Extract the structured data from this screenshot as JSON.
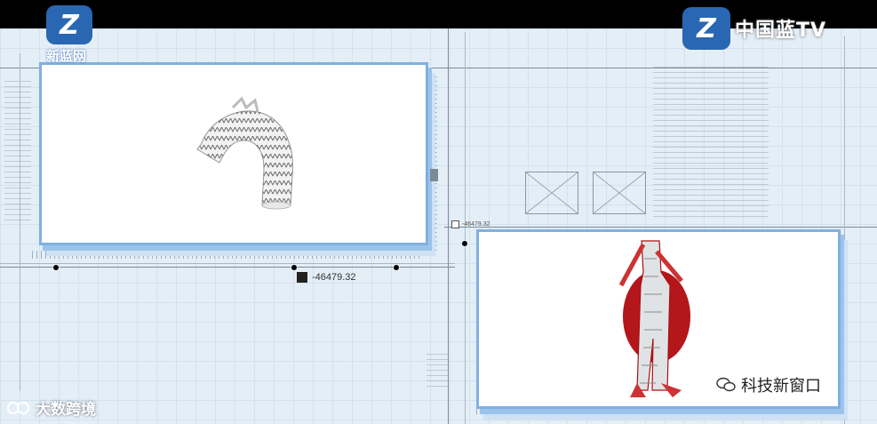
{
  "broadcast": {
    "left_logo_label": "新蓝网",
    "channel_name": "中国蓝TV",
    "watermark_left": "大数跨境",
    "watermark_right": "科技新窗口"
  },
  "canvas": {
    "coordinate_main": "-46479.32",
    "coordinate_small": "-46479.32"
  },
  "colors": {
    "panel_border": "#7fb0e2",
    "logo_blue": "#2a67b3",
    "aneurysm_red": "#b3161b"
  },
  "icons": [
    "zhejiang-tv-logo-icon",
    "wechat-icon",
    "watermark-logo-icon",
    "close-x-placeholder-icon"
  ]
}
